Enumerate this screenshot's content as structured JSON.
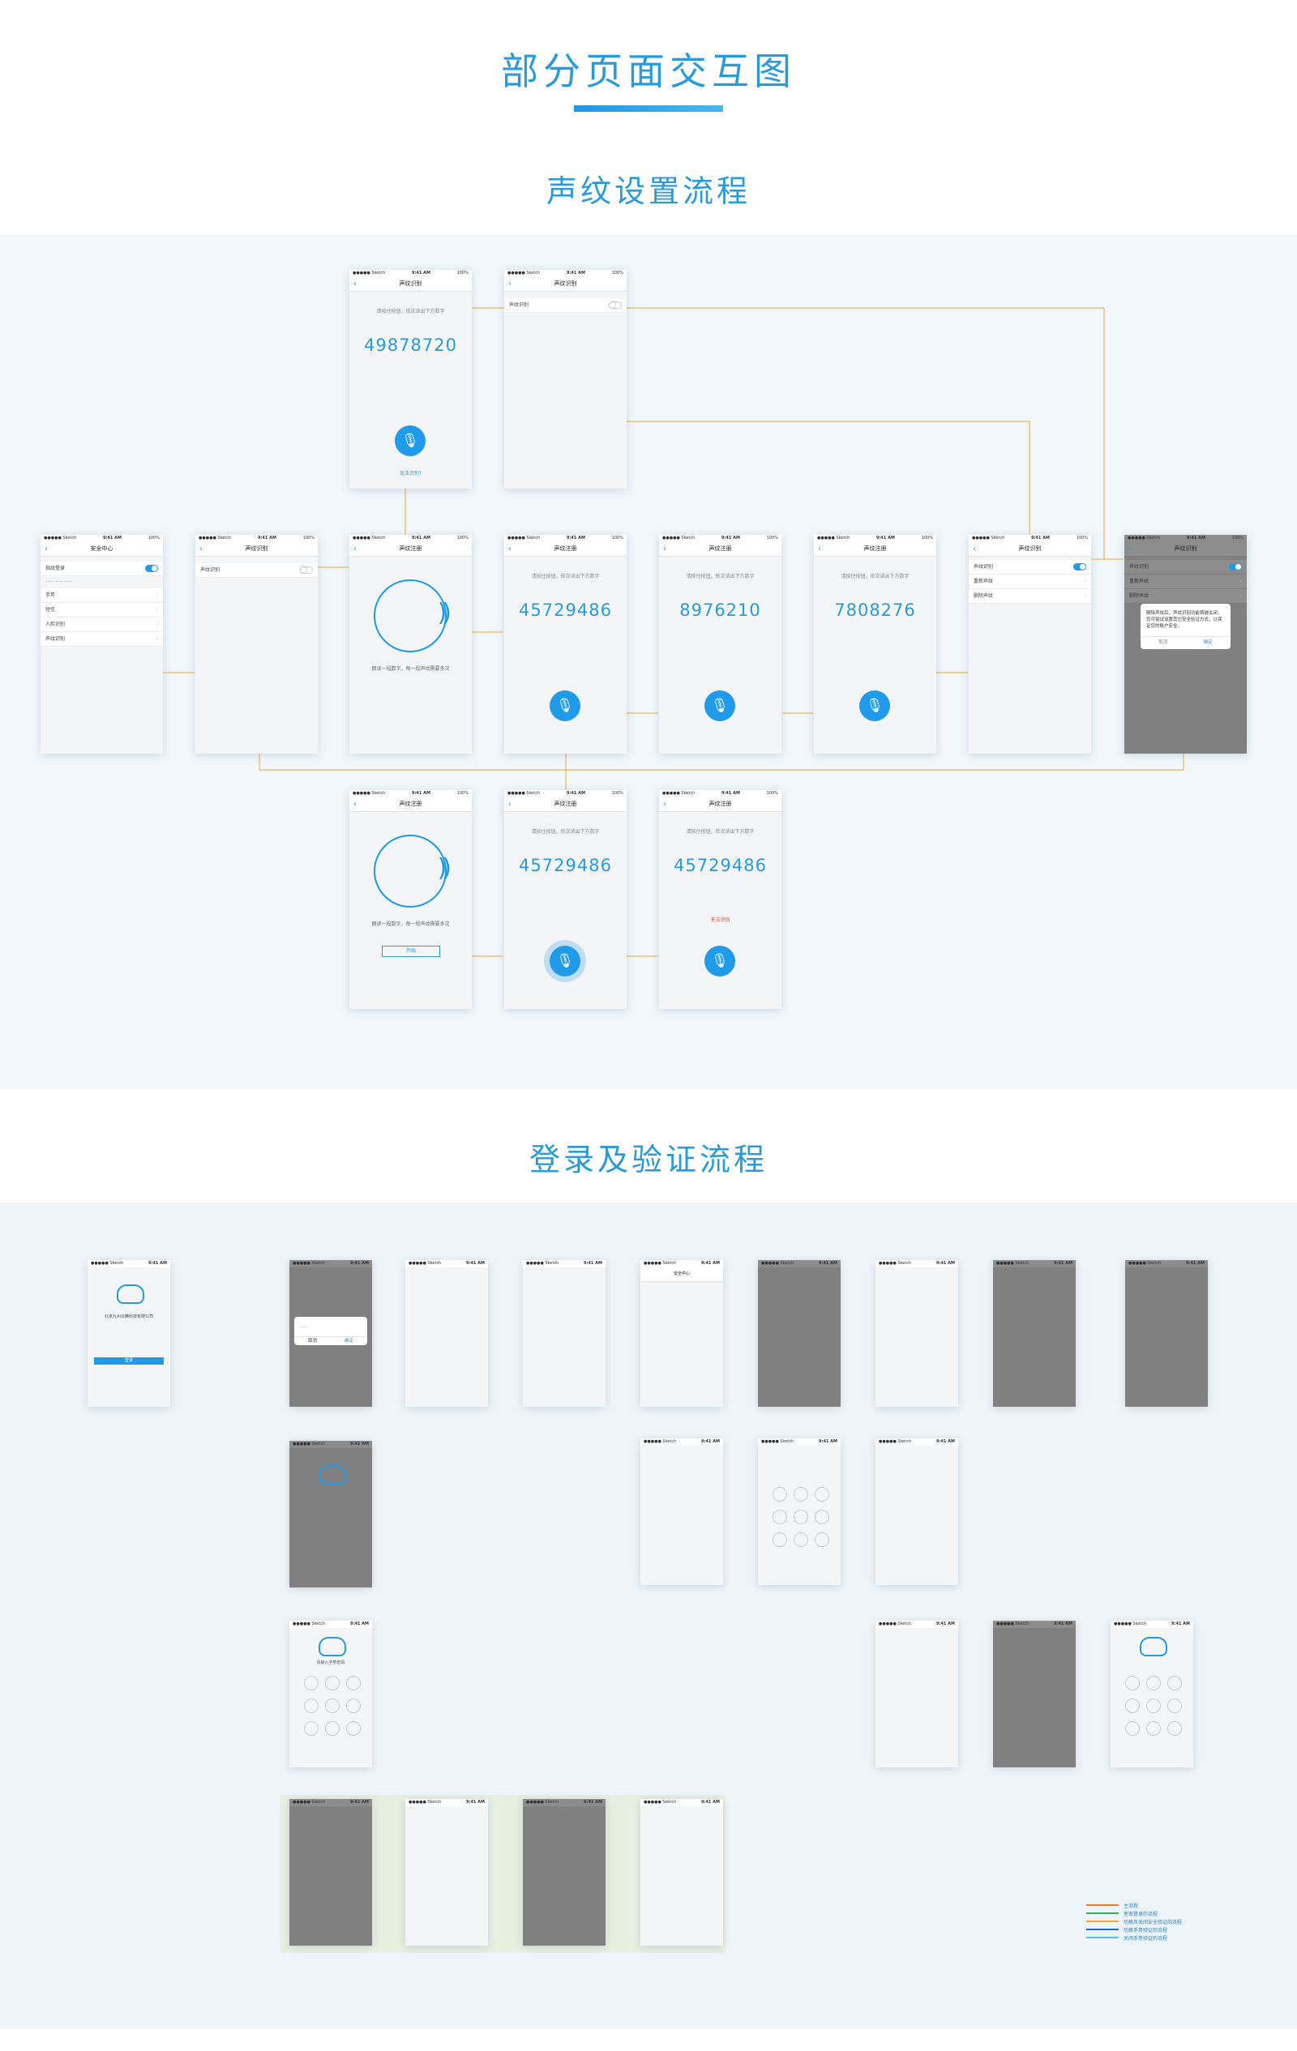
{
  "title": "部分页面交互图",
  "sections": {
    "voice": "声纹设置流程",
    "login": "登录及验证流程"
  },
  "status": {
    "carrier": "●●●●● Sketch",
    "time": "9:41 AM",
    "battery": "100%"
  },
  "screens": {
    "voiceprint_identify": "声纹识别",
    "voiceprint_register": "声纹注册",
    "security_center": "安全中心",
    "read_hint": "请根据提示，朗读以下数字",
    "register_hint": "请按住按钮，依次读出下方数字",
    "codes": [
      "49878720",
      "45729486",
      "8976210",
      "7808276",
      "45729486",
      "45729486"
    ],
    "retry_link": "无法识别?",
    "voice_fail": "无法识别",
    "fingerprint_login": "指纹登录",
    "voice_row": "声纹识别",
    "face_row": "人脸识别",
    "gesture_row": "手势",
    "sms_row": "短信",
    "retest_row": "重新声纹",
    "delete_row": "删除声纹",
    "delete_dialog": "删除声纹后，声纹识别功能将被关闭，您可尝试设置其它安全验证方式，以保证您的账户安全。",
    "cancel": "取消",
    "confirm": "确定",
    "face_hint": "朗读一段数字，每一段声纹需要多次",
    "start": "开始",
    "company": "北京九州云腾科技有限公司",
    "login_btn": "登录",
    "gesture_hint": "请输入手势密码"
  },
  "legend": [
    {
      "label": "主流程",
      "color": "#f07a2a"
    },
    {
      "label": "免密登录的流程",
      "color": "#3aa860"
    },
    {
      "label": "切换及关闭安全验证的流程",
      "color": "#f0a830"
    },
    {
      "label": "切换手势验证的流程",
      "color": "#1f6fd0"
    },
    {
      "label": "关闭手势验证的流程",
      "color": "#55c0f0"
    }
  ]
}
